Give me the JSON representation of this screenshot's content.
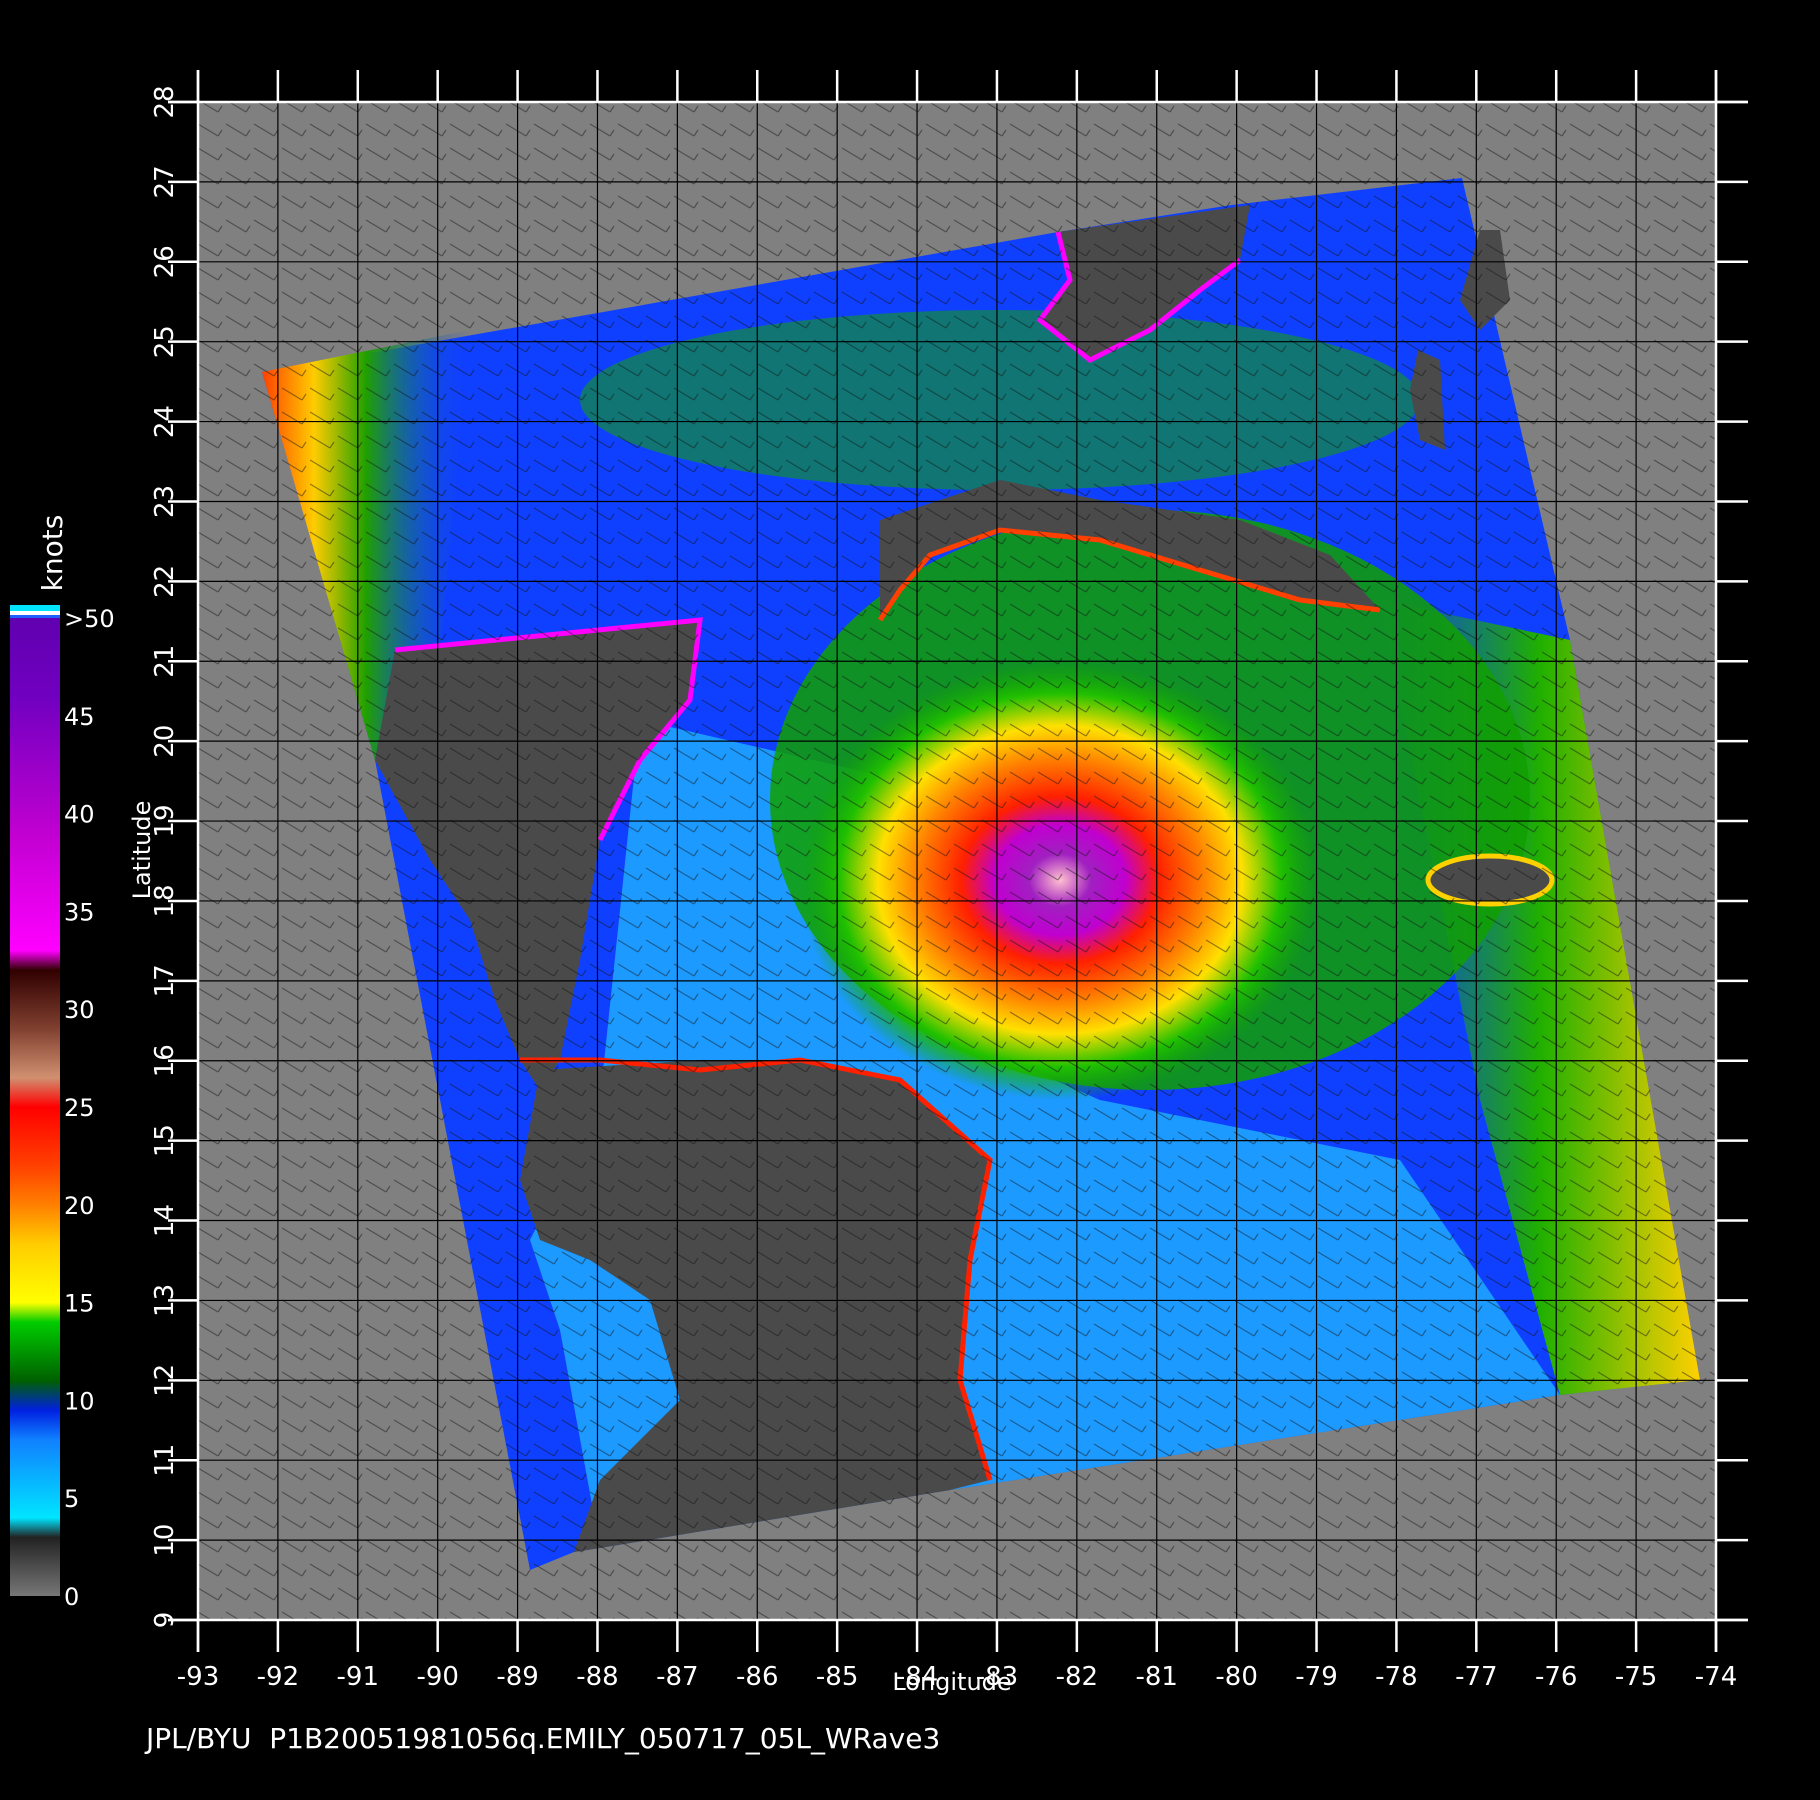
{
  "map": {
    "axes": {
      "x_label": "Longitude",
      "y_label": "Latitude",
      "x_ticks": [
        "-93",
        "-92",
        "-91",
        "-90",
        "-89",
        "-88",
        "-87",
        "-86",
        "-85",
        "-84",
        "-83",
        "-82",
        "-81",
        "-80",
        "-79",
        "-78",
        "-77",
        "-76",
        "-75",
        "-74"
      ],
      "y_ticks": [
        "9",
        "10",
        "11",
        "12",
        "13",
        "14",
        "15",
        "16",
        "17",
        "18",
        "19",
        "20",
        "21",
        "22",
        "23",
        "24",
        "25",
        "26",
        "27",
        "28"
      ],
      "x_range": [
        -93,
        -74
      ],
      "y_range": [
        9,
        28
      ]
    },
    "colorbar": {
      "title": "knots",
      "tick_labels": [
        "0",
        "5",
        "10",
        "15",
        "20",
        "25",
        "30",
        "35",
        "40",
        "45",
        ">50"
      ],
      "colors": [
        "#6a6a6a",
        "#00e5ff",
        "#0050ff",
        "#008000",
        "#ffff00",
        "#ff8000",
        "#ff0000",
        "#8a5030",
        "#ff00ff",
        "#8000c0"
      ]
    },
    "background_color": "#808080",
    "land_color": "#4a4a4a"
  },
  "caption": "JPL/BYU  P1B20051981056q.EMILY_050717_05L_WRave3"
}
